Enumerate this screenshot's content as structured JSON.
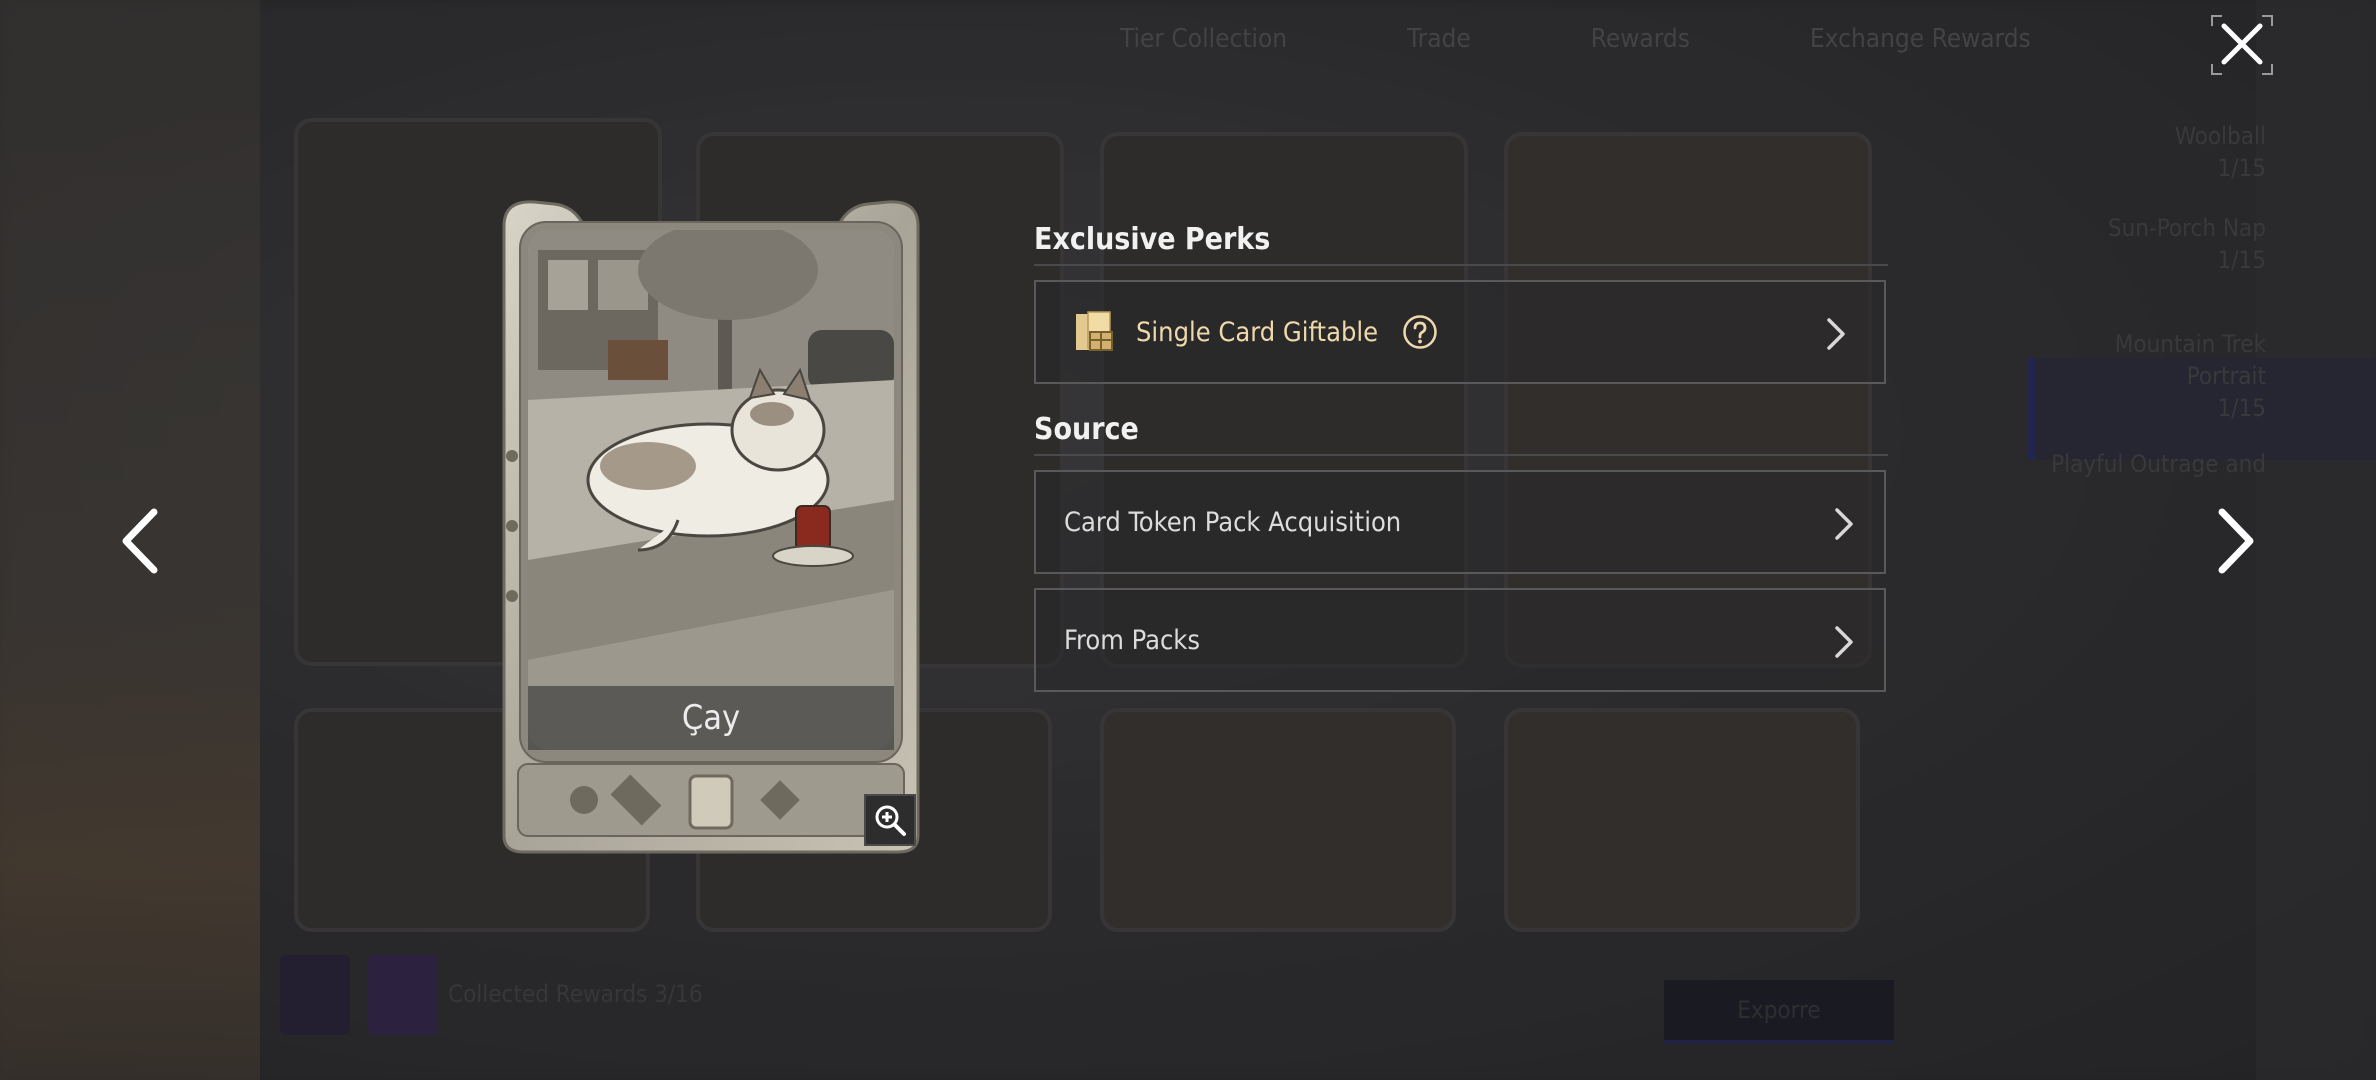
{
  "background": {
    "nav_items": [
      "Tier Collection",
      "Trade",
      "Rewards",
      "Exchange Rewards"
    ],
    "side_list": [
      "Woolball",
      "1/15",
      "Sun-Porch Nap",
      "1/15",
      "Mountain Trek",
      "Portrait",
      "1/15",
      "Playful Outrage and"
    ],
    "bottom_text": "Collected Rewards 3/16",
    "bottom_button": "Exporre"
  },
  "card": {
    "name": "Çay"
  },
  "perks": {
    "title": "Exclusive Perks",
    "items": [
      {
        "label": "Single Card Giftable"
      }
    ]
  },
  "source": {
    "title": "Source",
    "items": [
      {
        "label": "Card Token Pack Acquisition"
      },
      {
        "label": "From Packs"
      }
    ]
  },
  "icons": {
    "close": "close-icon",
    "prev": "chevron-left-icon",
    "next": "chevron-right-icon",
    "zoom": "zoom-in-icon",
    "help": "help-circle-icon",
    "gift": "gift-card-icon"
  },
  "colors": {
    "perk_text": "#efd9ac",
    "row_border": "#59595b"
  }
}
